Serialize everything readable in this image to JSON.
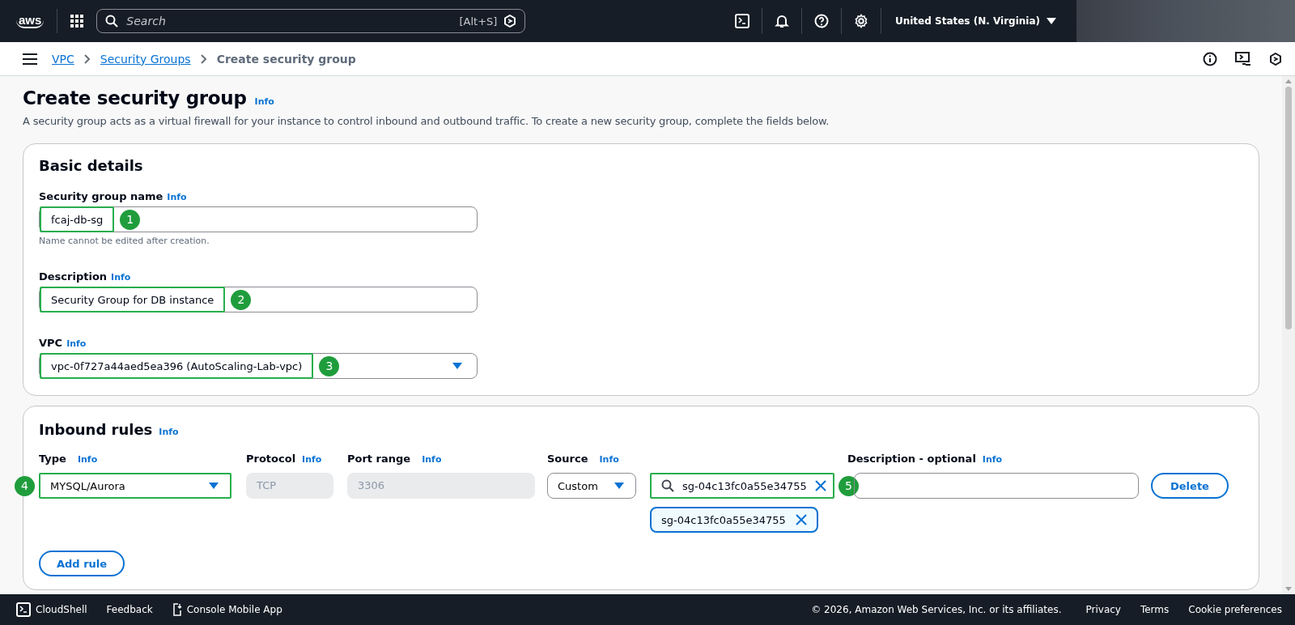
{
  "top_nav": {
    "logo": "aws",
    "search_placeholder": "Search",
    "shortcut": "[Alt+S]",
    "region": "United States (N. Virginia)"
  },
  "breadcrumbs": [
    {
      "label": "VPC",
      "kind": "link"
    },
    {
      "label": "Security Groups",
      "kind": "link"
    },
    {
      "label": "Create security group",
      "kind": "current"
    }
  ],
  "page": {
    "title": "Create security group",
    "info": "Info",
    "description": "A security group acts as a virtual firewall for your instance to control inbound and outbound traffic. To create a new security group, complete the fields below."
  },
  "basic_details": {
    "heading": "Basic details",
    "fields": [
      {
        "kind": "input",
        "label": "Security group name",
        "info": "Info",
        "value": "fcaj-db-sg",
        "hint": "Name cannot be edited after creation.",
        "callout": "1"
      },
      {
        "kind": "input",
        "label": "Description",
        "info": "Info",
        "value": "Security Group for DB instance",
        "callout": "2"
      },
      {
        "kind": "select",
        "label": "VPC",
        "info": "Info",
        "value": "vpc-0f727a44aed5ea396 (AutoScaling-Lab-vpc)",
        "callout": "3"
      }
    ]
  },
  "inbound_rules": {
    "heading": "Inbound rules",
    "info": "Info",
    "columns": [
      {
        "label": "Type",
        "info": "Info"
      },
      {
        "label": "Protocol",
        "info": "Info"
      },
      {
        "label": "Port range",
        "info": "Info"
      },
      {
        "label": "Source",
        "info": "Info"
      },
      {
        "label": "Description - optional",
        "info": "Info"
      }
    ],
    "rows": [
      {
        "type": {
          "value": "MYSQL/Aurora",
          "callout": "4"
        },
        "protocol": {
          "value": "TCP",
          "disabled": true
        },
        "port_range": {
          "value": "3306",
          "disabled": true
        },
        "source": "Custom",
        "source_search": {
          "value": "sg-04c13fc0a55e34755",
          "callout": "5"
        },
        "source_tokens": [
          "sg-04c13fc0a55e34755"
        ],
        "delete": "Delete"
      }
    ],
    "add_rule": "Add rule"
  },
  "footer": {
    "links": [
      {
        "label": "CloudShell",
        "kind": "cloudshell"
      },
      {
        "label": "Feedback",
        "kind": "plain"
      },
      {
        "label": "Console Mobile App",
        "kind": "mobile"
      }
    ],
    "copyright": "© 2026, Amazon Web Services, Inc. or its affiliates.",
    "right_links": [
      "Privacy",
      "Terms",
      "Cookie preferences"
    ]
  }
}
